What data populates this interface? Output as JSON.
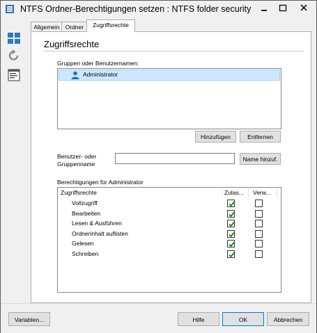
{
  "window": {
    "title": "NTFS Ordner-Berechtigungen setzen : NTFS folder security"
  },
  "sidebar": {
    "icons": [
      "layout-icon",
      "refresh-icon",
      "properties-icon"
    ]
  },
  "tabs": [
    "Allgemein",
    "Ordner",
    "Zugriffsrechte"
  ],
  "active_tab": "Zugriffsrechte",
  "page": {
    "title": "Zugriffsrechte",
    "groups_label": "Gruppen oder Benutzernamen:",
    "users": [
      "Administrator"
    ],
    "add_button": "Hinzufügen",
    "remove_button": "Entfernen",
    "name_label_line1": "Benutzer- oder",
    "name_label_line2": "Gruppenname",
    "name_value": "",
    "name_add_button": "Name hinzuf.",
    "permissions_label": "Berechtigungen für Administrator",
    "permissions_columns": [
      "Zugriffsrechte",
      "Zulas...",
      "Verw..."
    ],
    "permissions": [
      {
        "name": "Vollzugriff",
        "allow": true,
        "deny": false
      },
      {
        "name": "Bearbeiten",
        "allow": true,
        "deny": false
      },
      {
        "name": "Lesen & Ausführen",
        "allow": true,
        "deny": false
      },
      {
        "name": "Ordnerinhalt auflisten",
        "allow": true,
        "deny": false
      },
      {
        "name": "Gelesen",
        "allow": true,
        "deny": false
      },
      {
        "name": "Schreiben",
        "allow": true,
        "deny": false
      }
    ]
  },
  "footer": {
    "variables_button": "Variablen...",
    "help_button": "Hilfe",
    "ok_button": "OK",
    "cancel_button": "Abbrechen"
  },
  "colors": {
    "selection": "#cce8ff",
    "check": "#0a8a0a",
    "close_hover": "#ffffff"
  }
}
